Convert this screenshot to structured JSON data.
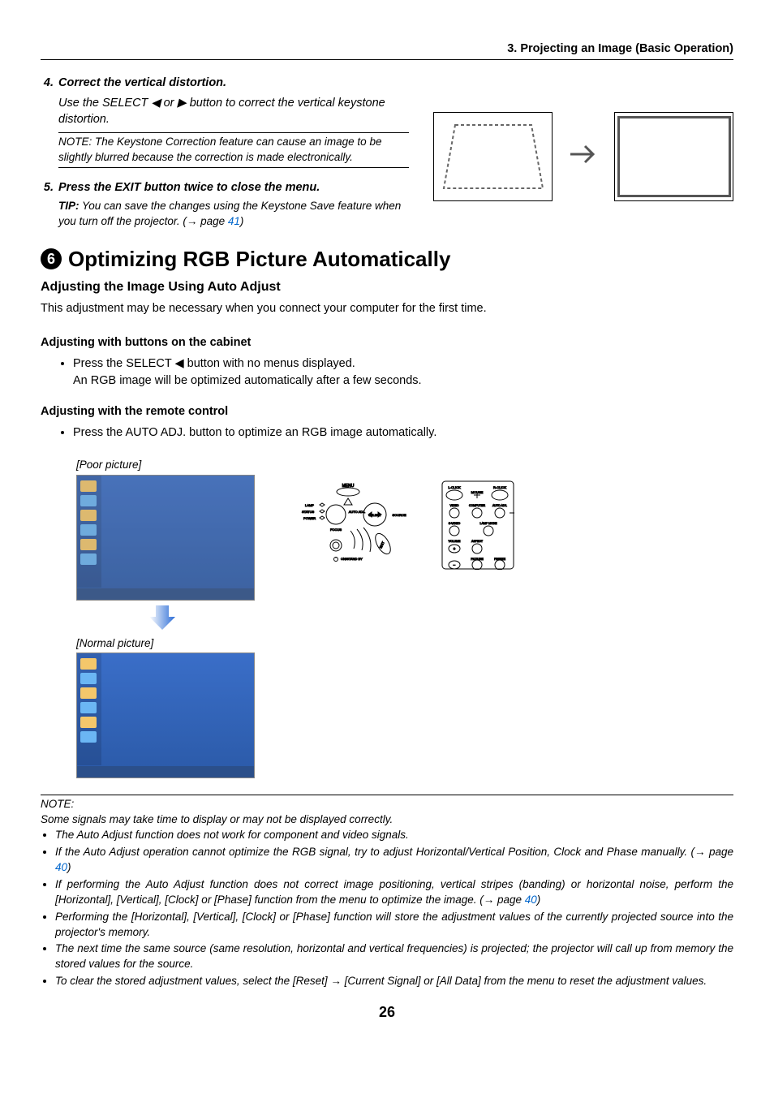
{
  "header": {
    "section": "3. Projecting an Image (Basic Operation)"
  },
  "step4": {
    "title": "Correct the vertical distortion.",
    "body": "Use the SELECT ◀ or ▶ button to correct the vertical keystone distortion.",
    "note": "NOTE: The Keystone Correction feature can cause an image to be slightly blurred because the correction is made electronically."
  },
  "step5": {
    "title": "Press the EXIT button twice to close the menu.",
    "tip_label": "TIP:",
    "tip_body_a": "You can save the changes using the Keystone Save feature when you turn off the projector. (→ page ",
    "tip_page": "41",
    "tip_body_b": ")"
  },
  "section6": {
    "num": "6",
    "title": "Optimizing RGB Picture Automatically",
    "sub": "Adjusting the Image Using Auto Adjust",
    "intro": "This adjustment may be necessary when you connect your computer for the first time."
  },
  "cabinet": {
    "heading": "Adjusting with buttons on the cabinet",
    "b1": "Press the SELECT ◀ button with no menus displayed.",
    "b2": "An RGB image will be optimized automatically after a few seconds."
  },
  "remote": {
    "heading": "Adjusting with the remote control",
    "b1": "Press the AUTO ADJ. button to optimize an RGB image automatically."
  },
  "captions": {
    "poor": "[Poor picture]",
    "normal": "[Normal picture]"
  },
  "panel_labels": {
    "menu": "MENU",
    "lamp": "LAMP",
    "status": "STATUS",
    "power": "POWER",
    "focus": "FOCUS",
    "auto": "AUTO ADJ.",
    "select": "SELECT",
    "source": "SOURCE",
    "standby": "ON/STAND BY",
    "exit": "EXIT"
  },
  "remote_labels": {
    "lclick": "L-CLICK",
    "rclick": "R-CLICK",
    "mouse": "MOUSE",
    "video": "VIDEO",
    "computer": "COMPUTER",
    "autoadj": "AUTO ADJ.",
    "svideo": "S-VIDEO",
    "lampmode": "LAMP MODE",
    "volume": "VOLUME",
    "aspect": "ASPECT",
    "picture": "PICTURE",
    "freeze": "FREEZE"
  },
  "notes": {
    "label": "NOTE:",
    "intro": "Some signals may take time to display or may not be displayed correctly.",
    "li1": "The Auto Adjust function does not work for component and video signals.",
    "li2a": "If the Auto Adjust operation cannot optimize the RGB signal, try to adjust Horizontal/Vertical Position, Clock and Phase manually. (→ page ",
    "li2p": "40",
    "li2b": ")",
    "li3a": "If performing the Auto Adjust function does not correct image positioning, vertical stripes (banding) or horizontal noise, perform the [Horizontal], [Vertical], [Clock] or [Phase] function from the menu to optimize the image. (→ page ",
    "li3p": "40",
    "li3b": ")",
    "li4": "Performing the [Horizontal], [Vertical], [Clock] or [Phase] function will store the adjustment values of the currently projected source into the projector's memory.",
    "li5": "The next time the same source (same resolution, horizontal and vertical frequencies) is projected; the projector will call up from memory the stored values for the source.",
    "li6": "To clear the stored adjustment values, select the [Reset] → [Current Signal] or [All Data] from the menu to reset the adjustment values."
  },
  "page_number": "26"
}
